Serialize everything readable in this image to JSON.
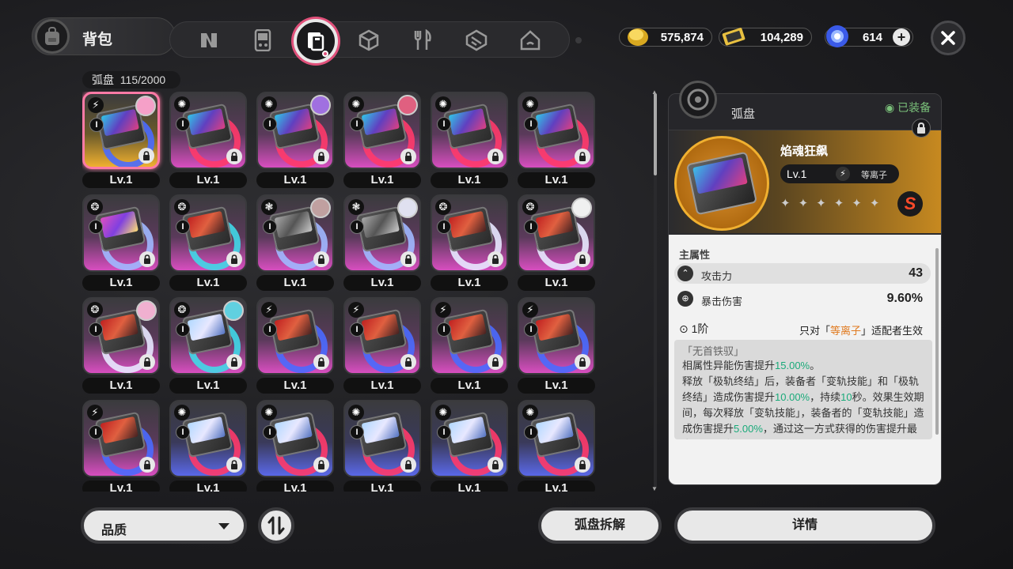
{
  "header": {
    "title": "背包",
    "tabs": [
      "tab-agents",
      "tab-device",
      "tab-drive-disc",
      "tab-materials",
      "tab-food",
      "tab-wengine",
      "tab-home"
    ],
    "active_tab": "tab-drive-disc"
  },
  "currency": {
    "gold": "575,874",
    "tickets": "104,289",
    "energy": "614"
  },
  "inventory": {
    "count_label": "弧盘",
    "count_value": "115/2000"
  },
  "grid": [
    {
      "grade": "gold",
      "selected": true,
      "elem": "⚡",
      "avatar": "#f5a0c8",
      "art": "cyan",
      "ring": "#4a6aff"
    },
    {
      "grade": "s",
      "elem": "✺",
      "avatar": null,
      "art": "cyan",
      "ring": "#ff3a6a"
    },
    {
      "grade": "s",
      "elem": "✺",
      "avatar": "#a070e0",
      "art": "cyan",
      "ring": "#ff3a6a"
    },
    {
      "grade": "s",
      "elem": "✺",
      "avatar": "#e06080",
      "art": "cyan",
      "ring": "#ff3a6a"
    },
    {
      "grade": "s",
      "elem": "✺",
      "avatar": null,
      "art": "cyan",
      "ring": "#ff3a6a"
    },
    {
      "grade": "s",
      "elem": "✺",
      "avatar": null,
      "art": "cyan",
      "ring": "#ff3a6a"
    },
    {
      "grade": "s",
      "elem": "❂",
      "avatar": null,
      "art": "pink",
      "ring": "#a0b8ff"
    },
    {
      "grade": "s",
      "elem": "❂",
      "avatar": null,
      "art": "red",
      "ring": "#40d8e8"
    },
    {
      "grade": "s",
      "elem": "❃",
      "avatar": "#c0a0a0",
      "art": "grey",
      "ring": "#a0b8ff"
    },
    {
      "grade": "s",
      "elem": "❃",
      "avatar": "#e0e0f0",
      "art": "grey",
      "ring": "#a0b8ff"
    },
    {
      "grade": "s",
      "elem": "❂",
      "avatar": null,
      "art": "red",
      "ring": "#e8e8ff"
    },
    {
      "grade": "s",
      "elem": "❂",
      "avatar": "#f0f0f0",
      "art": "red",
      "ring": "#e8e8ff"
    },
    {
      "grade": "s",
      "elem": "❂",
      "avatar": "#f0b0d0",
      "art": "red",
      "ring": "#e8e8ff"
    },
    {
      "grade": "s",
      "elem": "❂",
      "avatar": "#60d0e0",
      "art": "ice",
      "ring": "#40d8e8"
    },
    {
      "grade": "s",
      "elem": "⚡",
      "avatar": null,
      "art": "red",
      "ring": "#4a6aff"
    },
    {
      "grade": "s",
      "elem": "⚡",
      "avatar": null,
      "art": "red",
      "ring": "#4a6aff"
    },
    {
      "grade": "s",
      "elem": "⚡",
      "avatar": null,
      "art": "red",
      "ring": "#4a6aff"
    },
    {
      "grade": "s",
      "elem": "⚡",
      "avatar": null,
      "art": "red",
      "ring": "#4a6aff"
    },
    {
      "grade": "s",
      "elem": "⚡",
      "avatar": null,
      "art": "red",
      "ring": "#4a6aff"
    },
    {
      "grade": "a",
      "elem": "✺",
      "avatar": null,
      "art": "ice",
      "ring": "#ff3a6a"
    },
    {
      "grade": "a",
      "elem": "✺",
      "avatar": null,
      "art": "ice",
      "ring": "#ff3a6a"
    },
    {
      "grade": "a",
      "elem": "✺",
      "avatar": null,
      "art": "ice",
      "ring": "#ff3a6a"
    },
    {
      "grade": "a",
      "elem": "✺",
      "avatar": null,
      "art": "ice",
      "ring": "#ff3a6a"
    },
    {
      "grade": "a",
      "elem": "✺",
      "avatar": null,
      "art": "ice",
      "ring": "#ff3a6a"
    }
  ],
  "slot_label": "I",
  "level_label": "Lv.1",
  "detail": {
    "type": "弧盘",
    "equipped": "已装备",
    "name": "焰魂狂飙",
    "level": "Lv.1",
    "element": "等离子",
    "rank": "S",
    "main_attr_title": "主属性",
    "stats": [
      {
        "icon": "attack-icon",
        "name": "攻击力",
        "value": "43"
      },
      {
        "icon": "crit-icon",
        "name": "暴击伤害",
        "value": "9.60%"
      }
    ],
    "tier": "1阶",
    "tier_note_pre": "只对「",
    "tier_note_hl": "等离子",
    "tier_note_post": "」适配者生效",
    "quote": "「无首铁驭」",
    "desc_1_pre": "相属性异能伤害提升",
    "desc_1_val": "15.00%",
    "desc_1_post": "。",
    "desc_2": "释放「极轨终结」后，装备者「变轨技能」和「极轨终结」造成伤害提升",
    "desc_2_val": "10.00%",
    "desc_2_mid": "，持续",
    "desc_2_val2": "10",
    "desc_2_post": "秒。效果生效期间，每次释放「变轨技能」，装备者的「变轨技能」造成伤害提升",
    "desc_2_val3": "5.00%",
    "desc_2_end": "，通过这一方式获得的伤害提升最多叠加两次。"
  },
  "bottom": {
    "filter": "品质",
    "dismantle": "弧盘拆解",
    "details": "详情"
  },
  "colors": {
    "accent_pink": "#ff7aa6",
    "highlight_green": "#1aaa7a",
    "highlight_orange": "#e07a20",
    "equipped_green": "#7ac07a"
  }
}
